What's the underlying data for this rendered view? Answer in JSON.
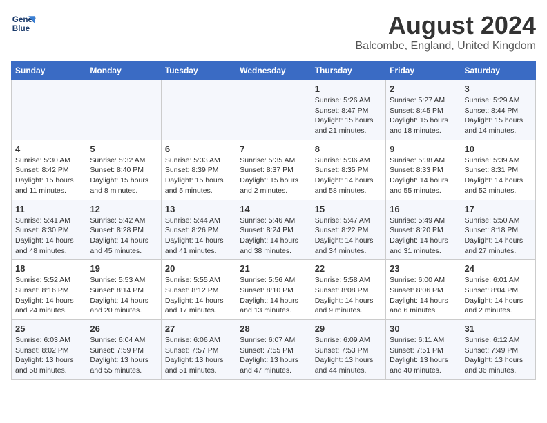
{
  "header": {
    "logo_line1": "General",
    "logo_line2": "Blue",
    "main_title": "August 2024",
    "subtitle": "Balcombe, England, United Kingdom"
  },
  "days_of_week": [
    "Sunday",
    "Monday",
    "Tuesday",
    "Wednesday",
    "Thursday",
    "Friday",
    "Saturday"
  ],
  "weeks": [
    [
      {
        "day": "",
        "info": ""
      },
      {
        "day": "",
        "info": ""
      },
      {
        "day": "",
        "info": ""
      },
      {
        "day": "",
        "info": ""
      },
      {
        "day": "1",
        "info": "Sunrise: 5:26 AM\nSunset: 8:47 PM\nDaylight: 15 hours and 21 minutes."
      },
      {
        "day": "2",
        "info": "Sunrise: 5:27 AM\nSunset: 8:45 PM\nDaylight: 15 hours and 18 minutes."
      },
      {
        "day": "3",
        "info": "Sunrise: 5:29 AM\nSunset: 8:44 PM\nDaylight: 15 hours and 14 minutes."
      }
    ],
    [
      {
        "day": "4",
        "info": "Sunrise: 5:30 AM\nSunset: 8:42 PM\nDaylight: 15 hours and 11 minutes."
      },
      {
        "day": "5",
        "info": "Sunrise: 5:32 AM\nSunset: 8:40 PM\nDaylight: 15 hours and 8 minutes."
      },
      {
        "day": "6",
        "info": "Sunrise: 5:33 AM\nSunset: 8:39 PM\nDaylight: 15 hours and 5 minutes."
      },
      {
        "day": "7",
        "info": "Sunrise: 5:35 AM\nSunset: 8:37 PM\nDaylight: 15 hours and 2 minutes."
      },
      {
        "day": "8",
        "info": "Sunrise: 5:36 AM\nSunset: 8:35 PM\nDaylight: 14 hours and 58 minutes."
      },
      {
        "day": "9",
        "info": "Sunrise: 5:38 AM\nSunset: 8:33 PM\nDaylight: 14 hours and 55 minutes."
      },
      {
        "day": "10",
        "info": "Sunrise: 5:39 AM\nSunset: 8:31 PM\nDaylight: 14 hours and 52 minutes."
      }
    ],
    [
      {
        "day": "11",
        "info": "Sunrise: 5:41 AM\nSunset: 8:30 PM\nDaylight: 14 hours and 48 minutes."
      },
      {
        "day": "12",
        "info": "Sunrise: 5:42 AM\nSunset: 8:28 PM\nDaylight: 14 hours and 45 minutes."
      },
      {
        "day": "13",
        "info": "Sunrise: 5:44 AM\nSunset: 8:26 PM\nDaylight: 14 hours and 41 minutes."
      },
      {
        "day": "14",
        "info": "Sunrise: 5:46 AM\nSunset: 8:24 PM\nDaylight: 14 hours and 38 minutes."
      },
      {
        "day": "15",
        "info": "Sunrise: 5:47 AM\nSunset: 8:22 PM\nDaylight: 14 hours and 34 minutes."
      },
      {
        "day": "16",
        "info": "Sunrise: 5:49 AM\nSunset: 8:20 PM\nDaylight: 14 hours and 31 minutes."
      },
      {
        "day": "17",
        "info": "Sunrise: 5:50 AM\nSunset: 8:18 PM\nDaylight: 14 hours and 27 minutes."
      }
    ],
    [
      {
        "day": "18",
        "info": "Sunrise: 5:52 AM\nSunset: 8:16 PM\nDaylight: 14 hours and 24 minutes."
      },
      {
        "day": "19",
        "info": "Sunrise: 5:53 AM\nSunset: 8:14 PM\nDaylight: 14 hours and 20 minutes."
      },
      {
        "day": "20",
        "info": "Sunrise: 5:55 AM\nSunset: 8:12 PM\nDaylight: 14 hours and 17 minutes."
      },
      {
        "day": "21",
        "info": "Sunrise: 5:56 AM\nSunset: 8:10 PM\nDaylight: 14 hours and 13 minutes."
      },
      {
        "day": "22",
        "info": "Sunrise: 5:58 AM\nSunset: 8:08 PM\nDaylight: 14 hours and 9 minutes."
      },
      {
        "day": "23",
        "info": "Sunrise: 6:00 AM\nSunset: 8:06 PM\nDaylight: 14 hours and 6 minutes."
      },
      {
        "day": "24",
        "info": "Sunrise: 6:01 AM\nSunset: 8:04 PM\nDaylight: 14 hours and 2 minutes."
      }
    ],
    [
      {
        "day": "25",
        "info": "Sunrise: 6:03 AM\nSunset: 8:02 PM\nDaylight: 13 hours and 58 minutes."
      },
      {
        "day": "26",
        "info": "Sunrise: 6:04 AM\nSunset: 7:59 PM\nDaylight: 13 hours and 55 minutes."
      },
      {
        "day": "27",
        "info": "Sunrise: 6:06 AM\nSunset: 7:57 PM\nDaylight: 13 hours and 51 minutes."
      },
      {
        "day": "28",
        "info": "Sunrise: 6:07 AM\nSunset: 7:55 PM\nDaylight: 13 hours and 47 minutes."
      },
      {
        "day": "29",
        "info": "Sunrise: 6:09 AM\nSunset: 7:53 PM\nDaylight: 13 hours and 44 minutes."
      },
      {
        "day": "30",
        "info": "Sunrise: 6:11 AM\nSunset: 7:51 PM\nDaylight: 13 hours and 40 minutes."
      },
      {
        "day": "31",
        "info": "Sunrise: 6:12 AM\nSunset: 7:49 PM\nDaylight: 13 hours and 36 minutes."
      }
    ]
  ]
}
